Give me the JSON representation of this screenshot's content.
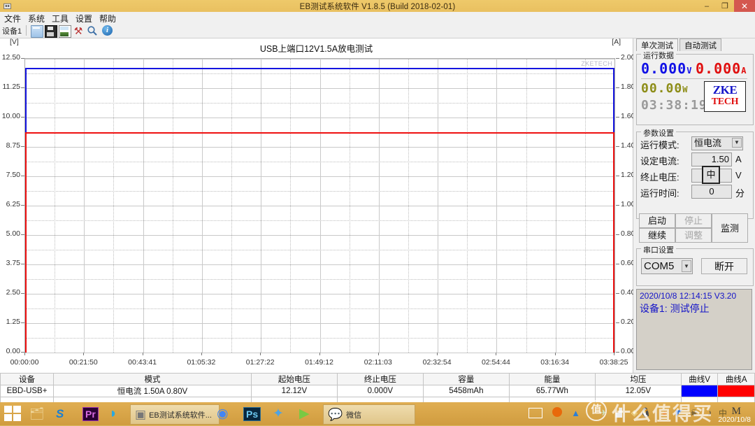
{
  "window": {
    "title": "EB测试系统软件 V1.8.5 (Build 2018-02-01)",
    "minimize": "–",
    "maximize": "❐",
    "close": "✕"
  },
  "menu": {
    "items": [
      "文件",
      "系统",
      "工具",
      "设置",
      "帮助"
    ]
  },
  "toolbar": {
    "device_tab": "设备1",
    "icons": [
      "open-file-icon",
      "save-icon",
      "image-export-icon",
      "tools-icon",
      "zoom-icon",
      "info-icon"
    ],
    "tools_glyph": "⚒",
    "search_glyph": "🔍",
    "info_glyph": "i"
  },
  "chart_data": {
    "type": "line",
    "title": "USB上端口12V1.5A放电测试",
    "watermark": "ZKETECH",
    "xlabel": "",
    "ylabel": "[V]",
    "y2label": "[A]",
    "xtick_labels": [
      "00:00:00",
      "00:21:50",
      "00:43:41",
      "01:05:32",
      "01:27:22",
      "01:49:12",
      "02:11:03",
      "02:32:54",
      "02:54:44",
      "03:16:34",
      "03:38:25"
    ],
    "ylim": [
      0.0,
      12.5
    ],
    "ytick_labels": [
      "12.50",
      "11.25",
      "10.00",
      "8.75",
      "7.50",
      "6.25",
      "5.00",
      "3.75",
      "2.50",
      "1.25",
      "0.00"
    ],
    "y2lim": [
      0.0,
      2.0
    ],
    "y2tick_labels": [
      "2.00",
      "1.80",
      "1.60",
      "1.40",
      "1.20",
      "1.00",
      "0.80",
      "0.60",
      "0.40",
      "0.20",
      "0.00"
    ],
    "grid": true,
    "legend": "none",
    "series": [
      {
        "name": "曲线V",
        "unit": "V",
        "axis": "left",
        "color": "#1414e0",
        "flat_value": 12.12,
        "x_start": "00:00:00",
        "x_end": "03:38:25"
      },
      {
        "name": "曲线A",
        "unit": "A",
        "axis": "right",
        "color": "#ee1111",
        "flat_value": 1.5,
        "x_start": "00:00:00",
        "x_end": "03:38:25"
      }
    ]
  },
  "right_panel": {
    "tabs": [
      {
        "label": "单次测试",
        "active": true
      },
      {
        "label": "自动测试",
        "active": false
      }
    ],
    "running_data": {
      "group_label": "运行数据",
      "voltage": "0.000",
      "voltage_unit": "V",
      "current": "0.000",
      "current_unit": "A",
      "power": "00.00",
      "power_unit": "W",
      "elapsed": "03:38:19",
      "logo_line1": "ZKE",
      "logo_line2": "TECH"
    },
    "params": {
      "group_label": "参数设置",
      "mode_label": "运行模式:",
      "mode_value": "恒电流",
      "current_label": "设定电流:",
      "current_value": "1.50",
      "current_unit": "A",
      "cutoff_label": "终止电压:",
      "cutoff_value": "",
      "cutoff_unit": "V",
      "ime_indicator": "中",
      "time_label": "运行时间:",
      "time_value": "0",
      "time_unit": "分",
      "buttons": [
        {
          "label": "启动",
          "enabled": true
        },
        {
          "label": "停止",
          "enabled": false
        },
        {
          "label": "继续",
          "enabled": true
        },
        {
          "label": "调整",
          "enabled": false
        },
        {
          "label": "监测",
          "enabled": true
        }
      ]
    },
    "serial": {
      "group_label": "串口设置",
      "port": "COM5",
      "disconnect_label": "断开"
    },
    "log": {
      "line1": "2020/10/8 12:14:15  V3.20",
      "line2": "设备1: 测试停止"
    }
  },
  "table": {
    "headers": [
      "设备",
      "模式",
      "起始电压",
      "终止电压",
      "容量",
      "能量",
      "均压",
      "曲线V",
      "曲线A"
    ],
    "rows": [
      {
        "device": "EBD-USB+",
        "mode": "恒电流 1.50A 0.80V",
        "start_voltage": "12.12V",
        "end_voltage": "0.000V",
        "capacity": "5458mAh",
        "energy": "65.77Wh",
        "avg_voltage": "12.05V",
        "curve_v_color": "#0000ff",
        "curve_a_color": "#ff0000"
      }
    ]
  },
  "taskbar": {
    "start_icon": "windows-logo-icon",
    "buttons": [
      {
        "name": "file-explorer-icon",
        "glyph": "🗂"
      },
      {
        "name": "sogou-icon",
        "glyph": "S"
      },
      {
        "name": "premiere-icon",
        "glyph": "Pr"
      },
      {
        "name": "quark-icon",
        "glyph": "◗"
      },
      {
        "name": "eb-software-icon",
        "glyph": "▣",
        "label": "EB测试系统软件...",
        "active": true
      },
      {
        "name": "chrome-icon",
        "glyph": "◉"
      },
      {
        "name": "photoshop-icon",
        "glyph": "Ps"
      },
      {
        "name": "foxmail-icon",
        "glyph": "✦"
      },
      {
        "name": "potplayer-icon",
        "glyph": "▶"
      },
      {
        "name": "wechat-icon",
        "glyph": "💬",
        "label": "微信"
      }
    ],
    "tray": [
      "keyboard-icon",
      "clock-icon",
      "signal-icon",
      "network-icon",
      "chart-icon",
      "shield-icon",
      "qq-icon",
      "flame-icon",
      "sail-icon",
      "pirate-icon",
      "volume-mute-icon",
      "ime-cn-icon",
      "ime-m-icon"
    ],
    "ime_cn": "中",
    "ime_m": "M",
    "date": "2020/10/8",
    "watermark": "什么值得买",
    "watermark_mark": "值"
  }
}
